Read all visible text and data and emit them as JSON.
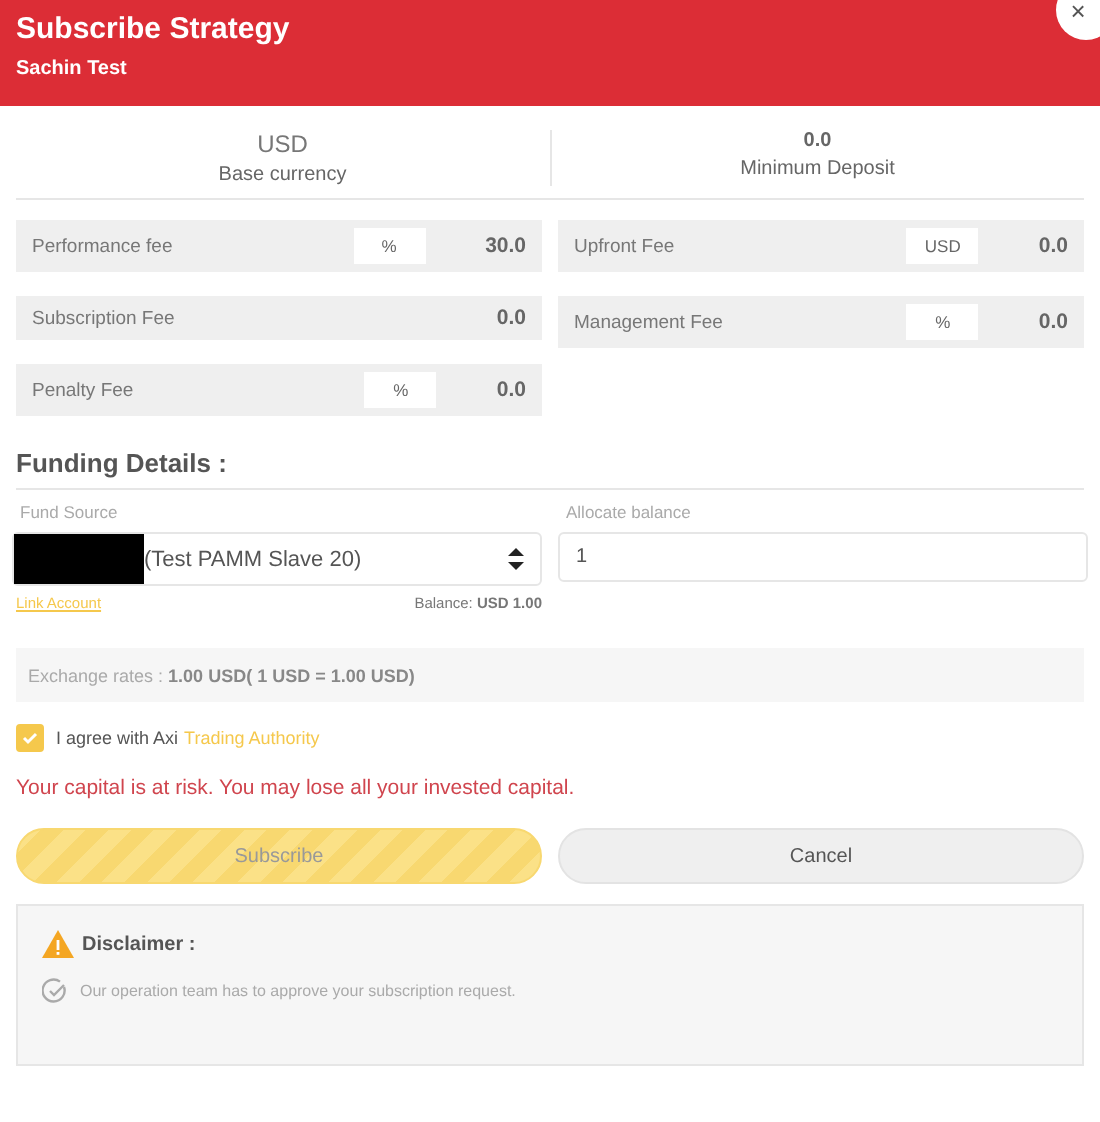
{
  "header": {
    "title": "Subscribe Strategy",
    "subtitle": "Sachin Test",
    "close": "×"
  },
  "summary": [
    {
      "value": "USD",
      "label": "Base currency"
    },
    {
      "value": "0.0",
      "label": "Minimum Deposit"
    }
  ],
  "fees_left": [
    {
      "label": "Performance fee",
      "unit": "%",
      "value": "30.0"
    },
    {
      "label": "Subscription Fee",
      "value": "0.0"
    },
    {
      "label": "Penalty Fee",
      "unit": "%",
      "value": "0.0"
    }
  ],
  "fees_right": [
    {
      "label": "Upfront Fee",
      "unit": "USD",
      "value": "0.0"
    },
    {
      "label": "Management Fee",
      "unit": "%",
      "value": "0.0"
    }
  ],
  "funding": {
    "heading": "Funding Details :",
    "fund_source_label": "Fund Source",
    "fund_source_value": "(Test PAMM Slave 20)",
    "allocate_label": "Allocate balance",
    "allocate_value": "1",
    "link": "Link Account",
    "balance": "Balance: **USD 1.00**"
  },
  "exchange": "Exchange rates : **1.00 USD( 1 USD = 1.00 USD)**",
  "agreement": {
    "checked": true,
    "text": "I agree with Axi",
    "link": "Trading Authority"
  },
  "warning": "Your capital is at risk. You may lose all your invested capital.",
  "buttons": [
    {
      "label": "Subscribe",
      "kind": "primary"
    },
    {
      "label": "Cancel",
      "kind": "secondary"
    }
  ],
  "disclaimer": {
    "title": "Disclaimer :",
    "items": [
      "Our operation team has to approve your subscription request."
    ]
  }
}
